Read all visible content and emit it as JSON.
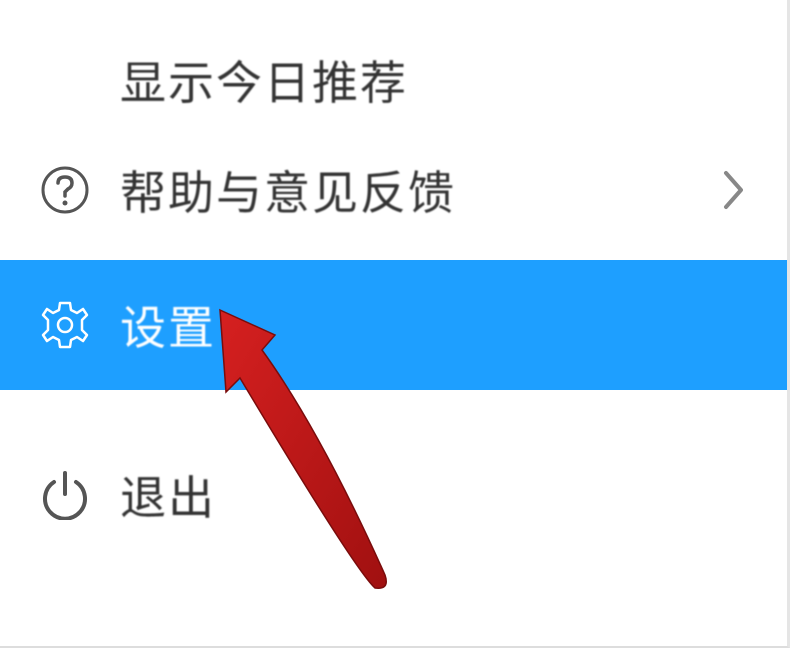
{
  "menu": {
    "items": [
      {
        "id": "recommend",
        "label": "显示今日推荐",
        "icon": null,
        "selected": false,
        "hasChevron": false
      },
      {
        "id": "help",
        "label": "帮助与意见反馈",
        "icon": "question-circle-icon",
        "selected": false,
        "hasChevron": true
      },
      {
        "id": "settings",
        "label": "设置",
        "icon": "gear-icon",
        "selected": true,
        "hasChevron": false
      },
      {
        "id": "exit",
        "label": "退出",
        "icon": "power-icon",
        "selected": false,
        "hasChevron": false
      }
    ]
  },
  "colors": {
    "selectedBg": "#1e9fff",
    "textDefault": "#333333",
    "textSelected": "#ffffff",
    "iconDefault": "#666666",
    "arrowAnnotation": "#c41e1e"
  }
}
